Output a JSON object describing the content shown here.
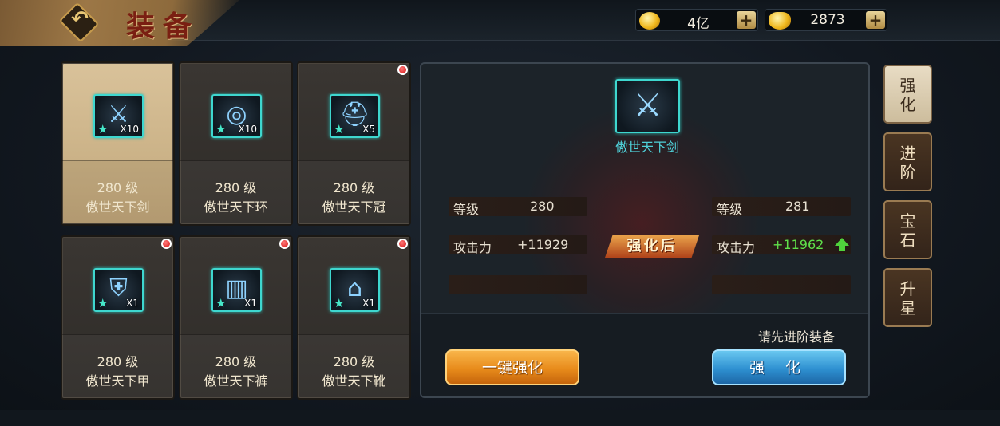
{
  "header": {
    "title": "装备",
    "back_icon": "back-arrow-icon",
    "currencies": [
      {
        "icon": "gold-coin-icon",
        "value": "4亿"
      },
      {
        "icon": "gold-ingot-icon",
        "value": "2873"
      }
    ],
    "add_label": "+"
  },
  "equipment": [
    {
      "level": "280 级",
      "name": "傲世天下剑",
      "qty": "X10",
      "icon": "sword-icon",
      "selected": true,
      "alert": false
    },
    {
      "level": "280 级",
      "name": "傲世天下环",
      "qty": "X10",
      "icon": "ring-icon",
      "selected": false,
      "alert": false
    },
    {
      "level": "280 级",
      "name": "傲世天下冠",
      "qty": "X5",
      "icon": "helmet-icon",
      "selected": false,
      "alert": true
    },
    {
      "level": "280 级",
      "name": "傲世天下甲",
      "qty": "X1",
      "icon": "armor-icon",
      "selected": false,
      "alert": true
    },
    {
      "level": "280 级",
      "name": "傲世天下裤",
      "qty": "X1",
      "icon": "pants-icon",
      "selected": false,
      "alert": true
    },
    {
      "level": "280 级",
      "name": "傲世天下靴",
      "qty": "X1",
      "icon": "boots-icon",
      "selected": false,
      "alert": true
    }
  ],
  "detail": {
    "item_name": "傲世天下剑",
    "current": {
      "level_label": "等级",
      "level": "280",
      "attack_label": "攻击力",
      "attack": "+11929"
    },
    "after_label": "强化后",
    "after": {
      "level_label": "等级",
      "level": "281",
      "attack_label": "攻击力",
      "attack": "+11962"
    },
    "hint": "请先进阶装备",
    "one_key_button": "一键强化",
    "enhance_button": "强 化"
  },
  "side_tabs": [
    {
      "label": "强化",
      "active": true
    },
    {
      "label": "进阶",
      "active": false
    },
    {
      "label": "宝石",
      "active": false
    },
    {
      "label": "升星",
      "active": false
    }
  ]
}
